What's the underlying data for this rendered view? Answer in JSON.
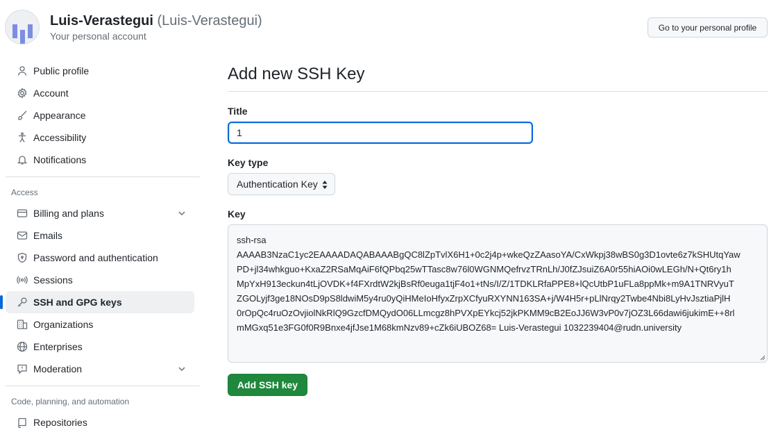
{
  "header": {
    "display_name": "Luis-Verastegui",
    "login": "(Luis-Verastegui)",
    "subtitle": "Your personal account",
    "profile_button": "Go to your personal profile"
  },
  "sidebar": {
    "items_top": [
      {
        "label": "Public profile",
        "icon": "person-icon"
      },
      {
        "label": "Account",
        "icon": "gear-icon"
      },
      {
        "label": "Appearance",
        "icon": "paintbrush-icon"
      },
      {
        "label": "Accessibility",
        "icon": "accessibility-icon"
      },
      {
        "label": "Notifications",
        "icon": "bell-icon"
      }
    ],
    "group_access": "Access",
    "items_access": [
      {
        "label": "Billing and plans",
        "icon": "credit-card-icon"
      },
      {
        "label": "Emails",
        "icon": "mail-icon"
      },
      {
        "label": "Password and authentication",
        "icon": "shield-lock-icon"
      },
      {
        "label": "Sessions",
        "icon": "broadcast-icon"
      },
      {
        "label": "SSH and GPG keys",
        "icon": "key-icon"
      },
      {
        "label": "Organizations",
        "icon": "organization-icon"
      },
      {
        "label": "Enterprises",
        "icon": "globe-icon"
      },
      {
        "label": "Moderation",
        "icon": "report-icon"
      }
    ],
    "group_code": "Code, planning, and automation",
    "items_code": [
      {
        "label": "Repositories",
        "icon": "repo-icon"
      }
    ]
  },
  "main": {
    "title": "Add new SSH Key",
    "title_label": "Title",
    "title_value": "1",
    "key_type_label": "Key type",
    "key_type_value": "Authentication Key",
    "key_label": "Key",
    "key_lines": [
      "ssh-rsa",
      "AAAAB3NzaC1yc2EAAAADAQABAAABgQC8lZpTvlX6H1+0c2j4p+wkeQzZAasoYA/CxWkpj38wBS0g3D1ovte6z7kSHUtqYaw",
      "PD+jl34whkguo+KxaZ2RSaMqAiF6fQPbq25wTTasc8w76l0WGNMQefrvzTRnLh/J0fZJsuiZ6A0r55hiAOi0wLEGh/N+Qt6ry1h",
      "MpYxH913eckun4tLjOVDK+f4FXrdtW2kjBsRf0euga1tjF4o1+tNs/I/Z/1TDKLRfaPPE8+lQcUtbP1uFLa8ppMk+m9A1TNRVyuT",
      "ZGOLyjf3ge18NOsD9pS8ldwiM5y4ru0yQiHMeIoHfyxZrpXCfyuRXYNN163SA+j/W4H5r+pLlNrqy2Twbe4Nbi8LyHvJsztiaPjlH",
      "0rOpQc4ruOzOvjiolNkRlQ9GzcfDMQydO06LLmcgz8hPVXpEYkcj52jkPKMM9cB2EoJJ6W3vP0v7jOZ3L66dawi6jukimE++8rl",
      "mMGxq51e3FG0f0R9Bnxe4jfJse1M68kmNzv89+cZk6iUBOZ68= Luis-Verastegui 1032239404@rudn.university"
    ],
    "submit_label": "Add SSH key"
  }
}
